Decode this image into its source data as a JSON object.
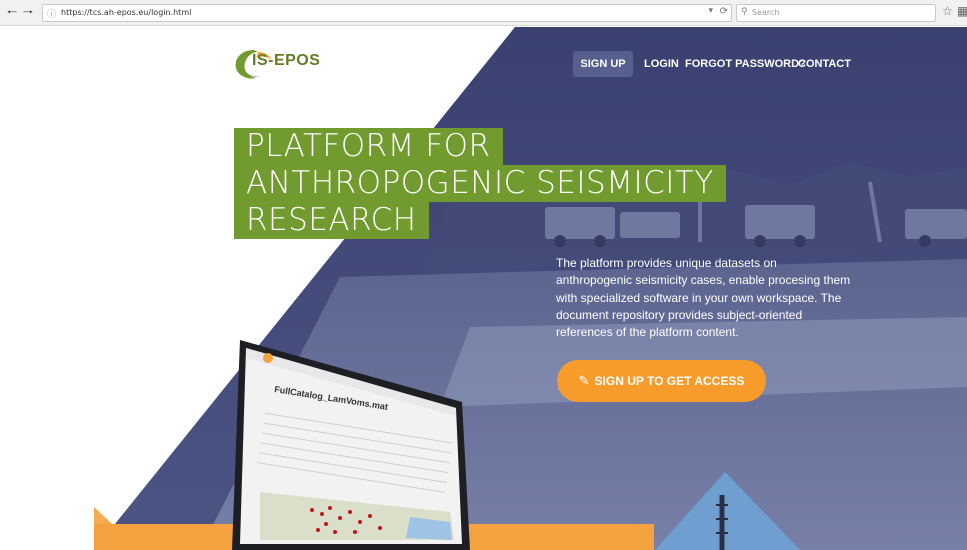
{
  "browser": {
    "back_icon": "back-arrow-icon",
    "forward_icon": "forward-arrow-icon",
    "url": "https://tcs.ah-epos.eu/login.html",
    "search_placeholder": "Search",
    "bookmark_icon": "star-icon",
    "clipboard_icon": "clipboard-icon"
  },
  "brand": {
    "logo_text": "IS-EPOS",
    "logo_colors": {
      "green": "#719a2f",
      "orange": "#f4a23f",
      "gray": "#8a8a8a"
    }
  },
  "nav": {
    "signup": "SIGN UP",
    "login": "LOGIN",
    "forgot": "FORGOT PASSWORD?",
    "contact": "CONTACT"
  },
  "hero": {
    "headline_lines": [
      "PLATFORM FOR",
      "ANTHROPOGENIC SEISMICITY",
      "RESEARCH"
    ],
    "description": "The platform provides unique datasets on anthropogenic seismicity cases, enable procesing them with specialized software in your own workspace. The document repository provides subject-oriented references of the platform content.",
    "cta_label": "SIGN UP TO GET ACCESS",
    "cta_icon": "pencil-icon"
  },
  "colors": {
    "hero_navy": "#3c4370",
    "headline_green": "#719a2f",
    "cta_orange": "#f79b2b",
    "band_orange": "#f4a23f"
  },
  "monitor_screen": {
    "title": "FullCatalog_LamVoms.mat"
  }
}
